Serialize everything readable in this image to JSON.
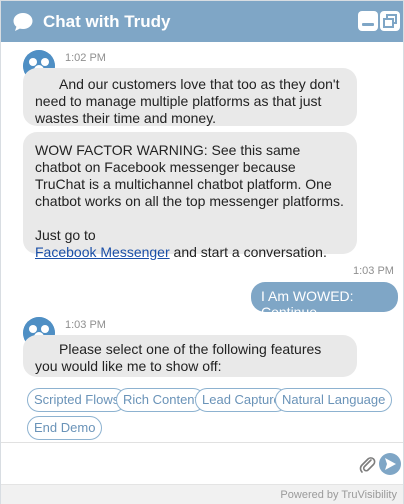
{
  "header": {
    "title": "Chat with Trudy",
    "icons": [
      "chat-bubble-icon",
      "minimize-icon",
      "popout-icon"
    ]
  },
  "messages": [
    {
      "sender": "bot",
      "time": "1:02 PM",
      "text": "And our customers love that too as they don't need to manage multiple platforms as that just wastes their time and money."
    },
    {
      "sender": "bot",
      "paragraph1": "WOW FACTOR WARNING: See this same chatbot on Facebook messenger because TruChat is a multichannel chatbot platform. One chatbot works on all the top messenger platforms.",
      "paragraph2_prefix": "Just go to",
      "link_text": "Facebook Messenger",
      "paragraph2_suffix": " and start a conversation."
    },
    {
      "sender": "user",
      "time": "1:03 PM",
      "text": "I Am WOWED: Continue"
    },
    {
      "sender": "bot",
      "time": "1:03 PM",
      "text": "Please select one of the following features you would like me to show off:"
    }
  ],
  "quick_replies": [
    "Scripted Flows",
    "Rich Content",
    "Lead Capture",
    "Natural Language",
    "End Demo"
  ],
  "composer": {
    "placeholder": "",
    "attach_icon": "paperclip-icon",
    "send_icon": "send-arrow-icon"
  },
  "footer": {
    "powered_by": "Powered by TruVisibility"
  },
  "colors": {
    "header": "#7fa6c6",
    "bot_bubble": "#e9e9e9",
    "user_bubble": "#7fa6c6",
    "link": "#1a4fa8",
    "chip_border": "#8db2d0"
  }
}
